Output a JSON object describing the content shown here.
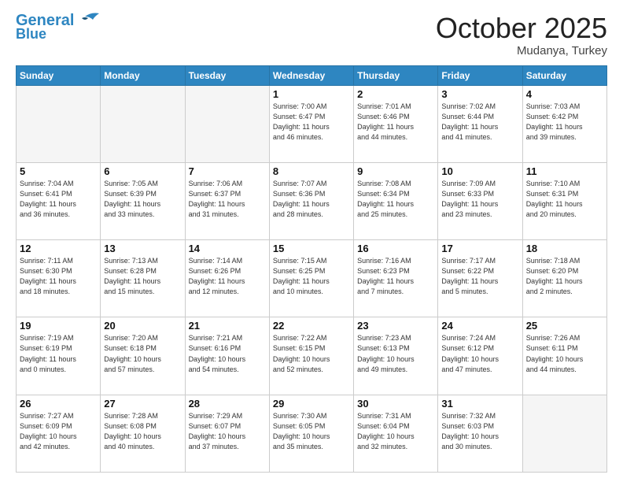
{
  "header": {
    "logo_line1": "General",
    "logo_line2": "Blue",
    "month": "October 2025",
    "location": "Mudanya, Turkey"
  },
  "weekdays": [
    "Sunday",
    "Monday",
    "Tuesday",
    "Wednesday",
    "Thursday",
    "Friday",
    "Saturday"
  ],
  "days": [
    {
      "num": "",
      "info": "",
      "empty": true
    },
    {
      "num": "",
      "info": "",
      "empty": true
    },
    {
      "num": "",
      "info": "",
      "empty": true
    },
    {
      "num": "1",
      "info": "Sunrise: 7:00 AM\nSunset: 6:47 PM\nDaylight: 11 hours\nand 46 minutes."
    },
    {
      "num": "2",
      "info": "Sunrise: 7:01 AM\nSunset: 6:46 PM\nDaylight: 11 hours\nand 44 minutes."
    },
    {
      "num": "3",
      "info": "Sunrise: 7:02 AM\nSunset: 6:44 PM\nDaylight: 11 hours\nand 41 minutes."
    },
    {
      "num": "4",
      "info": "Sunrise: 7:03 AM\nSunset: 6:42 PM\nDaylight: 11 hours\nand 39 minutes."
    },
    {
      "num": "5",
      "info": "Sunrise: 7:04 AM\nSunset: 6:41 PM\nDaylight: 11 hours\nand 36 minutes."
    },
    {
      "num": "6",
      "info": "Sunrise: 7:05 AM\nSunset: 6:39 PM\nDaylight: 11 hours\nand 33 minutes."
    },
    {
      "num": "7",
      "info": "Sunrise: 7:06 AM\nSunset: 6:37 PM\nDaylight: 11 hours\nand 31 minutes."
    },
    {
      "num": "8",
      "info": "Sunrise: 7:07 AM\nSunset: 6:36 PM\nDaylight: 11 hours\nand 28 minutes."
    },
    {
      "num": "9",
      "info": "Sunrise: 7:08 AM\nSunset: 6:34 PM\nDaylight: 11 hours\nand 25 minutes."
    },
    {
      "num": "10",
      "info": "Sunrise: 7:09 AM\nSunset: 6:33 PM\nDaylight: 11 hours\nand 23 minutes."
    },
    {
      "num": "11",
      "info": "Sunrise: 7:10 AM\nSunset: 6:31 PM\nDaylight: 11 hours\nand 20 minutes."
    },
    {
      "num": "12",
      "info": "Sunrise: 7:11 AM\nSunset: 6:30 PM\nDaylight: 11 hours\nand 18 minutes."
    },
    {
      "num": "13",
      "info": "Sunrise: 7:13 AM\nSunset: 6:28 PM\nDaylight: 11 hours\nand 15 minutes."
    },
    {
      "num": "14",
      "info": "Sunrise: 7:14 AM\nSunset: 6:26 PM\nDaylight: 11 hours\nand 12 minutes."
    },
    {
      "num": "15",
      "info": "Sunrise: 7:15 AM\nSunset: 6:25 PM\nDaylight: 11 hours\nand 10 minutes."
    },
    {
      "num": "16",
      "info": "Sunrise: 7:16 AM\nSunset: 6:23 PM\nDaylight: 11 hours\nand 7 minutes."
    },
    {
      "num": "17",
      "info": "Sunrise: 7:17 AM\nSunset: 6:22 PM\nDaylight: 11 hours\nand 5 minutes."
    },
    {
      "num": "18",
      "info": "Sunrise: 7:18 AM\nSunset: 6:20 PM\nDaylight: 11 hours\nand 2 minutes."
    },
    {
      "num": "19",
      "info": "Sunrise: 7:19 AM\nSunset: 6:19 PM\nDaylight: 11 hours\nand 0 minutes."
    },
    {
      "num": "20",
      "info": "Sunrise: 7:20 AM\nSunset: 6:18 PM\nDaylight: 10 hours\nand 57 minutes."
    },
    {
      "num": "21",
      "info": "Sunrise: 7:21 AM\nSunset: 6:16 PM\nDaylight: 10 hours\nand 54 minutes."
    },
    {
      "num": "22",
      "info": "Sunrise: 7:22 AM\nSunset: 6:15 PM\nDaylight: 10 hours\nand 52 minutes."
    },
    {
      "num": "23",
      "info": "Sunrise: 7:23 AM\nSunset: 6:13 PM\nDaylight: 10 hours\nand 49 minutes."
    },
    {
      "num": "24",
      "info": "Sunrise: 7:24 AM\nSunset: 6:12 PM\nDaylight: 10 hours\nand 47 minutes."
    },
    {
      "num": "25",
      "info": "Sunrise: 7:26 AM\nSunset: 6:11 PM\nDaylight: 10 hours\nand 44 minutes."
    },
    {
      "num": "26",
      "info": "Sunrise: 7:27 AM\nSunset: 6:09 PM\nDaylight: 10 hours\nand 42 minutes."
    },
    {
      "num": "27",
      "info": "Sunrise: 7:28 AM\nSunset: 6:08 PM\nDaylight: 10 hours\nand 40 minutes."
    },
    {
      "num": "28",
      "info": "Sunrise: 7:29 AM\nSunset: 6:07 PM\nDaylight: 10 hours\nand 37 minutes."
    },
    {
      "num": "29",
      "info": "Sunrise: 7:30 AM\nSunset: 6:05 PM\nDaylight: 10 hours\nand 35 minutes."
    },
    {
      "num": "30",
      "info": "Sunrise: 7:31 AM\nSunset: 6:04 PM\nDaylight: 10 hours\nand 32 minutes."
    },
    {
      "num": "31",
      "info": "Sunrise: 7:32 AM\nSunset: 6:03 PM\nDaylight: 10 hours\nand 30 minutes."
    },
    {
      "num": "",
      "info": "",
      "empty": true
    }
  ]
}
